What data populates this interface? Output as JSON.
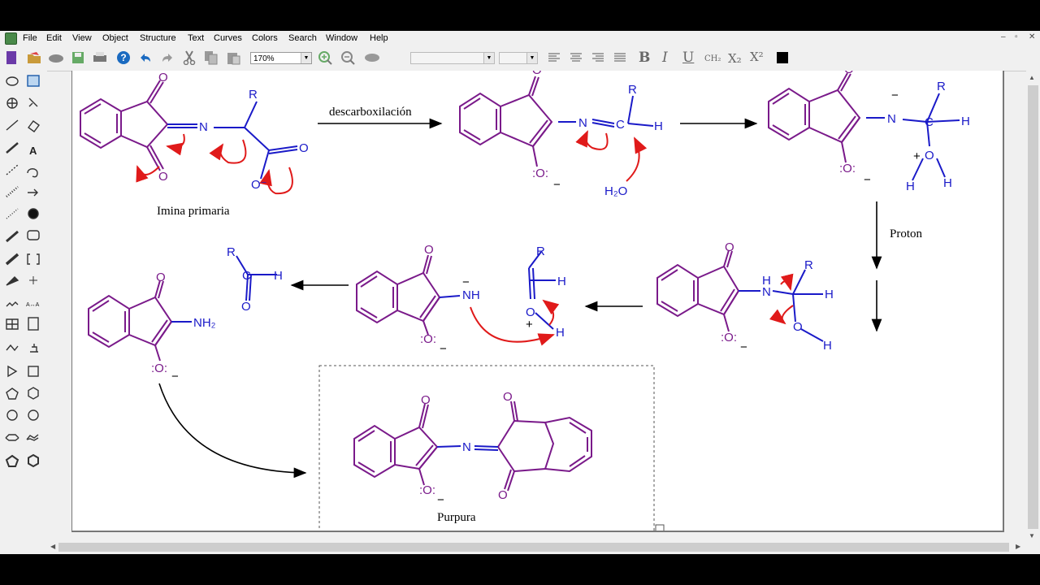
{
  "menu": [
    "File",
    "Edit",
    "View",
    "Object",
    "Structure",
    "Text",
    "Curves",
    "Colors",
    "Search",
    "Window",
    "Help"
  ],
  "toolbar": {
    "zoom": "170%",
    "format_labels": {
      "subscript_ch2": "CH₂",
      "subscript": "X₂",
      "superscript": "X²"
    }
  },
  "icons": {
    "left_tools": [
      "lasso-icon",
      "marquee-select-icon",
      "rotate-icon",
      "eraser-icon",
      "bond-icon",
      "text-icon",
      "dashed-bond-icon",
      "arrow-icon",
      "filled-circle-icon",
      "wedge-bond-icon",
      "rounded-rectangle-icon",
      "bracket-icon",
      "pen-icon",
      "charge-icon",
      "chain-icon",
      "atom-map-icon",
      "table-icon",
      "document-icon",
      "curve-icon",
      "stamp-icon",
      "triangle-icon",
      "square-icon",
      "pentagon-icon",
      "hexagon-icon",
      "cyclooctane-icon",
      "cyclohexane-icon",
      "boat-icon",
      "chair-icon",
      "pentagon-ring-icon",
      "benzene-icon"
    ]
  },
  "colors": {
    "ring": "#7a1a8a",
    "chain": "#1a1ac8",
    "arrow_curved": "#e01a1a",
    "text": "#000000"
  },
  "diagram": {
    "labels": {
      "imina_primaria": "Imina primaria",
      "descarboxilacion": "descarboxilación",
      "proton": "Proton",
      "purpura": "Purpura"
    },
    "atoms": {
      "O": "O",
      "N": "N",
      "R": "R",
      "H": "H",
      "C": "C",
      "NH": "NH",
      "NH2": "NH₂",
      "H2O": "H₂O",
      "O_minus": "O⁻",
      "lone_pair_O": ":O:",
      "minus": "−",
      "plus": "+"
    }
  }
}
